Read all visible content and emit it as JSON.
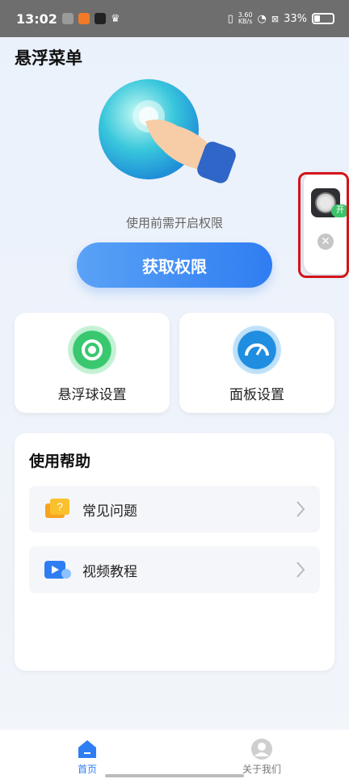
{
  "status_bar": {
    "time": "13:02",
    "speed_value": "3.60",
    "speed_unit": "KB/s",
    "battery": "33%"
  },
  "page": {
    "title": "悬浮菜单"
  },
  "permission": {
    "hint": "使用前需开启权限",
    "button_label": "获取权限"
  },
  "cards": {
    "float_ball": "悬浮球设置",
    "panel": "面板设置"
  },
  "help": {
    "title": "使用帮助",
    "items": [
      {
        "label": "常见问题"
      },
      {
        "label": "视频教程"
      }
    ]
  },
  "floating_widget": {
    "tag": "开",
    "close": "✕"
  },
  "bottom_nav": {
    "home": "首页",
    "about": "关于我们"
  },
  "colors": {
    "primary": "#2f7df2",
    "accent_green": "#3cc36a",
    "highlight": "#d4141a"
  }
}
